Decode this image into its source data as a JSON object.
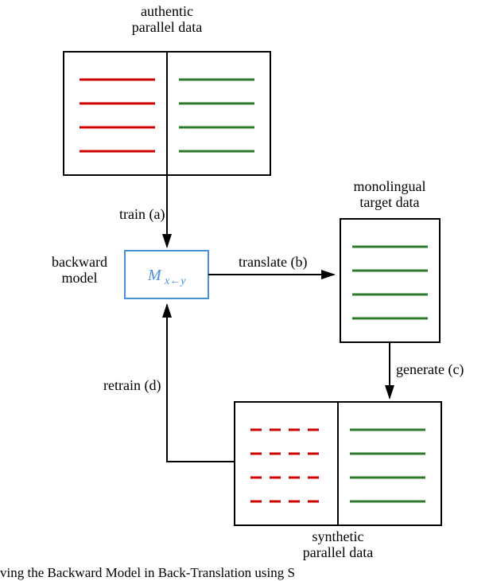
{
  "labels": {
    "authentic1": "authentic",
    "authentic2": "parallel data",
    "mono1": "monolingual",
    "mono2": "target data",
    "synth1": "synthetic",
    "synth2": "parallel data",
    "backward1": "backward",
    "backward2": "model",
    "train": "train (a)",
    "translate": "translate (b)",
    "generate": "generate (c)",
    "retrain": "retrain (d)",
    "modelM": "M",
    "modelSub": "x←y"
  },
  "caption": "ving the Backward Model in Back-Translation using S",
  "colors": {
    "red": "#cc0000",
    "green": "#2d7a2d",
    "blue": "#4a90d9",
    "black": "#000000"
  }
}
